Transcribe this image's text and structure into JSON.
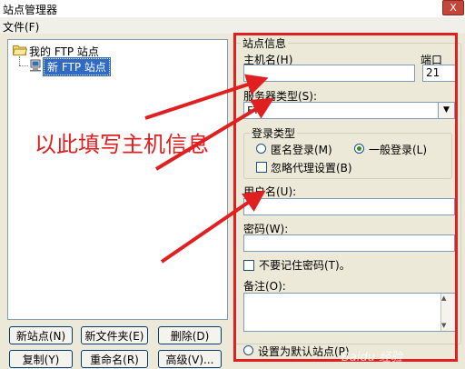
{
  "window": {
    "title": "站点管理器",
    "close_glyph": "X"
  },
  "menu": {
    "file": "文件(F)"
  },
  "tree": {
    "root_label": "我的 FTP 站点",
    "root_icon": "folder-open-icon",
    "child_label": "新 FTP 站点",
    "child_icon": "computer-icon"
  },
  "buttons": {
    "new_site": "新站点(N)",
    "new_folder": "新文件夹(E)",
    "delete": "删除(D)",
    "copy": "复制(Y)",
    "rename": "重命名(R)",
    "advanced": "高级(V)..."
  },
  "site_info": {
    "legend": "站点信息",
    "host_label": "主机名(H)",
    "host_value": "",
    "port_label": "端口",
    "port_value": "21",
    "type_label": "服务器类型(S):",
    "type_value": "FTP",
    "login_legend": "登录类型",
    "login_anonymous": "匿名登录(M)",
    "login_normal": "一般登录(L)",
    "login_selected": "normal",
    "ignore_proxy": "忽略代理设置(B)",
    "user_label": "用户名(U):",
    "user_value": "",
    "pass_label": "密码(W):",
    "pass_value": "",
    "no_save_pass": "不要记住密码(T)。",
    "note_label": "备注(O):",
    "note_value": "",
    "set_default": "设置为默认站点(P)"
  },
  "annotation": {
    "text": "以此填写主机信息",
    "color": "#e02020"
  },
  "watermark": "Baidu 经验",
  "colors": {
    "accent": "#316ac5",
    "annotation_red": "#e02020",
    "window_bg": "#ece9d8"
  }
}
